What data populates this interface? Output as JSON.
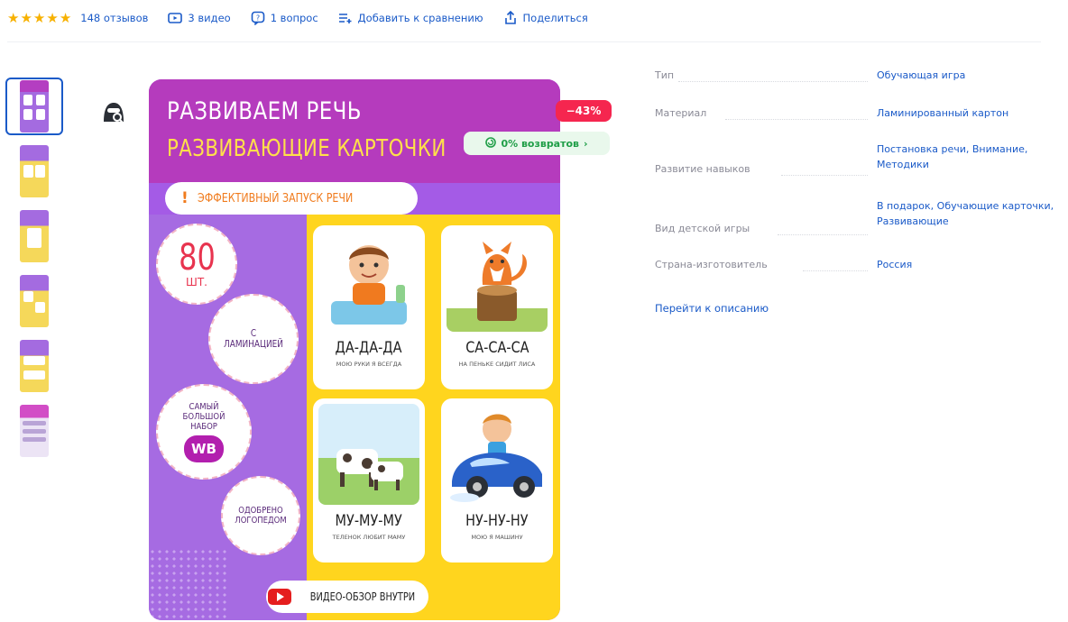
{
  "rating": {
    "stars": 5,
    "reviews": "148 отзывов"
  },
  "meta": {
    "videos": "3 видео",
    "questions": "1 вопрос",
    "compare": "Добавить к сравнению",
    "share": "Поделиться"
  },
  "product_image": {
    "title1": "РАЗВИВАЕМ РЕЧЬ",
    "title2": "РАЗВИВАЮЩИЕ КАРТОЧКИ",
    "pill": "ЭФФЕКТИВНЫЙ ЗАПУСК РЕЧИ",
    "count_num": "80",
    "count_unit": "ШТ.",
    "laminated": "С ЛАМИНАЦИЕЙ",
    "biggest": "САМЫЙ БОЛЬШОЙ НАБОР",
    "wb": "WB",
    "approved": "ОДОБРЕНО ЛОГОПЕДОМ",
    "video_review": "ВИДЕО-ОБЗОР ВНУТРИ",
    "cards": [
      {
        "word": "ДА-ДА-ДА",
        "sub": "МОЮ РУКИ Я ВСЕГДА"
      },
      {
        "word": "СА-СА-СА",
        "sub": "НА ПЕНЬКЕ СИДИТ ЛИСА"
      },
      {
        "word": "МУ-МУ-МУ",
        "sub": "ТЕЛЕНОК ЛЮБИТ МАМУ"
      },
      {
        "word": "НУ-НУ-НУ",
        "sub": "МОЮ Я МАШИНУ"
      }
    ]
  },
  "badges": {
    "discount": "−43%",
    "returns": "0% возвратов"
  },
  "specs": [
    {
      "key": "Тип",
      "value": "Обучающая игра"
    },
    {
      "key": "Материал",
      "value": "Ламинированный картон"
    },
    {
      "key": "Развитие навыков",
      "value": "Постановка речи, Вниманиe, Методики"
    },
    {
      "key": "Вид детской игры",
      "value": "В подарок, Обучающие карточки, Развивающие"
    },
    {
      "key": "Страна-изготовитель",
      "value": "Россия"
    }
  ],
  "go_to_description": "Перейти к описанию",
  "colors": {
    "accent": "#1a5ac8",
    "star": "#f7b100",
    "discount": "#f5264f",
    "returns": "#1f9e47"
  }
}
